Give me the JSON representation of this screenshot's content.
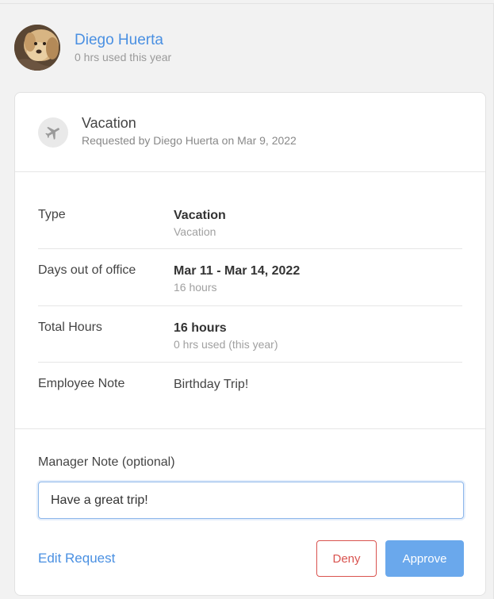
{
  "employee": {
    "name": "Diego Huerta",
    "usage": "0 hrs used this year"
  },
  "request": {
    "title": "Vacation",
    "requested_by": "Requested by Diego Huerta on Mar 9, 2022",
    "icon": "airplane-icon"
  },
  "details": [
    {
      "label": "Type",
      "value": "Vacation",
      "sub": "Vacation"
    },
    {
      "label": "Days out of office",
      "value": "Mar 11 - Mar 14, 2022",
      "sub": "16 hours"
    },
    {
      "label": "Total Hours",
      "value": "16 hours",
      "sub": "0 hrs used (this year)"
    },
    {
      "label": "Employee Note",
      "value": "Birthday Trip!"
    }
  ],
  "manager_note": {
    "label": "Manager Note (optional)",
    "value": "Have a great trip!"
  },
  "actions": {
    "edit_label": "Edit Request",
    "deny_label": "Deny",
    "approve_label": "Approve"
  },
  "colors": {
    "link": "#4a90e2",
    "deny": "#d9534f",
    "approve": "#6aa8ec"
  }
}
